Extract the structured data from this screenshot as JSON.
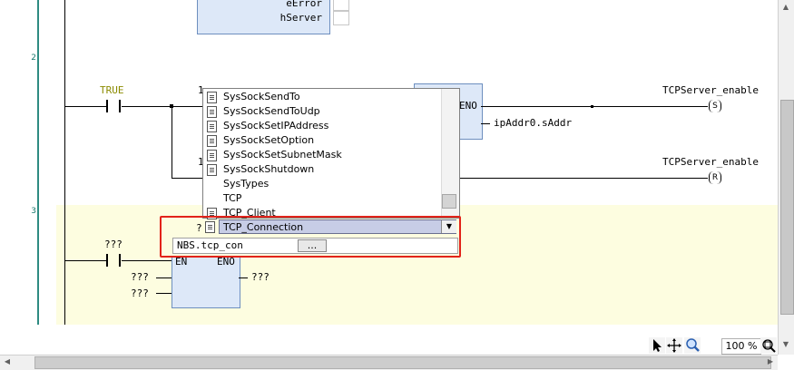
{
  "rows": {
    "r2": "2",
    "r3": "3"
  },
  "fb_top": {
    "out1": "eError",
    "out2": "hServer"
  },
  "rung2": {
    "contact_var": "TRUE",
    "pin_1a": "1",
    "pin_1b": "1",
    "fb_output": "ENO",
    "fb_output_var": "ipAddr0.sAddr",
    "coil_set_var": "TCPServer_enable",
    "coil_set_symbol": "S",
    "coil_reset_var": "TCPServer_enable",
    "coil_reset_symbol": "R"
  },
  "rung3": {
    "contact_var": "???",
    "fb_en": "EN",
    "fb_eno": "ENO",
    "in1": "???",
    "in2": "???",
    "out1": "???",
    "question": "?"
  },
  "popup": {
    "items": [
      {
        "label": "SysSockSendTo",
        "icon": true
      },
      {
        "label": "SysSockSendToUdp",
        "icon": true
      },
      {
        "label": "SysSockSetIPAddress",
        "icon": true
      },
      {
        "label": "SysSockSetOption",
        "icon": true
      },
      {
        "label": "SysSockSetSubnetMask",
        "icon": true
      },
      {
        "label": "SysSockShutdown",
        "icon": true
      },
      {
        "label": "SysTypes",
        "icon": false
      },
      {
        "label": "TCP",
        "icon": false
      },
      {
        "label": "TCP_Client",
        "icon": true
      }
    ],
    "selected": "TCP_Connection"
  },
  "instance": {
    "value": "NBS.tcp_con",
    "browse_label": "..."
  },
  "status": {
    "zoom": "100 %"
  },
  "icons": [
    "pointer-icon",
    "move-icon",
    "magnifier-icon",
    "zoom-icon"
  ]
}
